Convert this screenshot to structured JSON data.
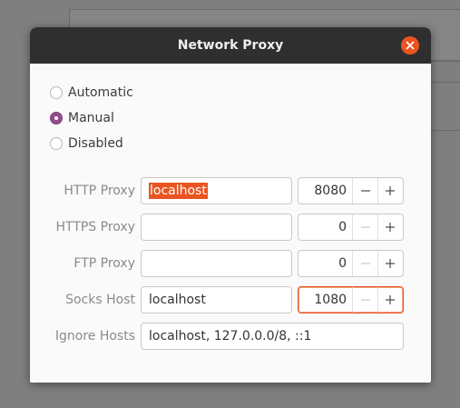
{
  "window": {
    "title": "Network Proxy"
  },
  "method": {
    "options": [
      {
        "label": "Automatic",
        "checked": false
      },
      {
        "label": "Manual",
        "checked": true
      },
      {
        "label": "Disabled",
        "checked": false
      }
    ]
  },
  "proxies": {
    "http": {
      "label": "HTTP Proxy",
      "host": "localhost",
      "port": "8080"
    },
    "https": {
      "label": "HTTPS Proxy",
      "host": "",
      "port": "0"
    },
    "ftp": {
      "label": "FTP Proxy",
      "host": "",
      "port": "0"
    },
    "socks": {
      "label": "Socks Host",
      "host": "localhost",
      "port": "1080"
    }
  },
  "ignore": {
    "label": "Ignore Hosts",
    "value": "localhost, 127.0.0.0/8, ::1"
  },
  "icons": {
    "close": "close-icon",
    "decrement": "minus-icon",
    "increment": "plus-icon"
  },
  "colors": {
    "accent": "#e95420",
    "radio_checked": "#924d8b",
    "titlebar": "#2f2f2f"
  }
}
